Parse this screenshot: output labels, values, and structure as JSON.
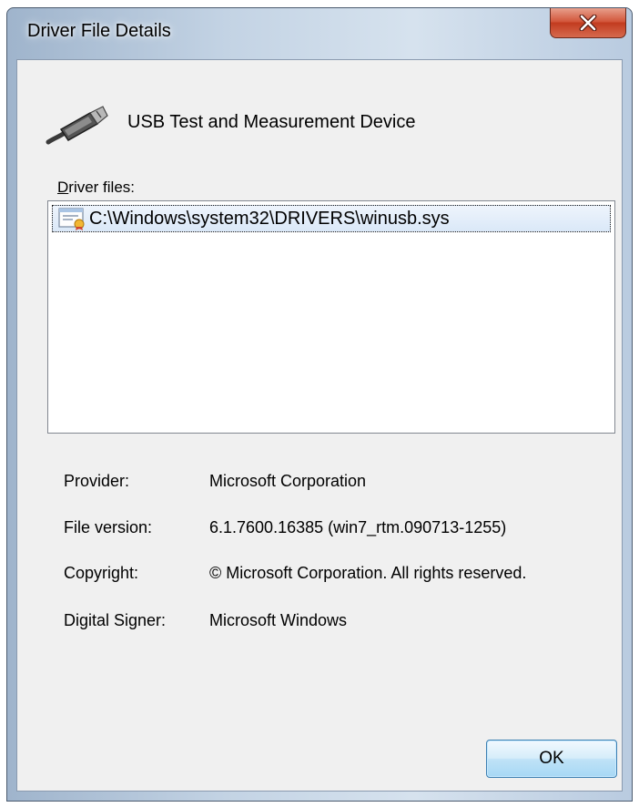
{
  "dialog": {
    "title": "Driver File Details",
    "close_icon": "close-icon"
  },
  "device": {
    "icon": "usb-cable-icon",
    "name": "USB Test and Measurement Device"
  },
  "files": {
    "label_underlined": "D",
    "label_rest": "river files:",
    "items": [
      {
        "icon": "certificate-file-icon",
        "path": "C:\\Windows\\system32\\DRIVERS\\winusb.sys",
        "selected": true
      }
    ]
  },
  "details": {
    "provider_label": "Provider:",
    "provider_value": "Microsoft Corporation",
    "version_label": "File version:",
    "version_value": "6.1.7600.16385 (win7_rtm.090713-1255)",
    "copyright_label": "Copyright:",
    "copyright_value": "© Microsoft Corporation. All rights reserved.",
    "signer_label": "Digital Signer:",
    "signer_value": "Microsoft Windows"
  },
  "buttons": {
    "ok_label": "OK"
  },
  "colors": {
    "close_button": "#c8462a",
    "ok_button_border": "#3c7fb1",
    "selection": "#dae8f8",
    "client_background": "#f0f0f0"
  }
}
